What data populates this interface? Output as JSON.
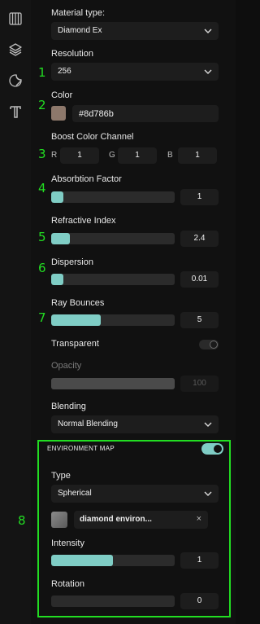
{
  "sidebar": {
    "icons": [
      "panel-grid-icon",
      "layers-icon",
      "sticker-icon",
      "text-icon"
    ]
  },
  "material": {
    "label": "Material type:",
    "value": "Diamond Ex"
  },
  "resolution": {
    "label": "Resolution",
    "value": "256"
  },
  "color": {
    "label": "Color",
    "hex": "#8d786b"
  },
  "boost": {
    "label": "Boost Color Channel",
    "r_label": "R",
    "r": "1",
    "g_label": "G",
    "g": "1",
    "b_label": "B",
    "b": "1"
  },
  "absorption": {
    "label": "Absorbtion Factor",
    "value": "1",
    "fill": 0.1
  },
  "refractive": {
    "label": "Refractive Index",
    "value": "2.4",
    "fill": 0.15
  },
  "dispersion": {
    "label": "Dispersion",
    "value": "0.01",
    "fill": 0.1
  },
  "bounces": {
    "label": "Ray Bounces",
    "value": "5",
    "fill": 0.4
  },
  "transparent": {
    "label": "Transparent",
    "enabled": false
  },
  "opacity": {
    "label": "Opacity",
    "value": "100",
    "fill": 1.0
  },
  "blending": {
    "label": "Blending",
    "value": "Normal Blending"
  },
  "env": {
    "title": "ENVIRONMENT MAP",
    "enabled": true,
    "type_label": "Type",
    "type_value": "Spherical",
    "file_name": "diamond environ...",
    "remove": "×",
    "intensity_label": "Intensity",
    "intensity_value": "1",
    "intensity_fill": 0.5,
    "rotation_label": "Rotation",
    "rotation_value": "0",
    "rotation_fill": 0.0
  },
  "annotations": [
    "1",
    "2",
    "3",
    "4",
    "5",
    "6",
    "7",
    "8"
  ],
  "colors": {
    "accent": "#7fcdc5",
    "annotation": "#22dd22",
    "panel": "#111111"
  }
}
